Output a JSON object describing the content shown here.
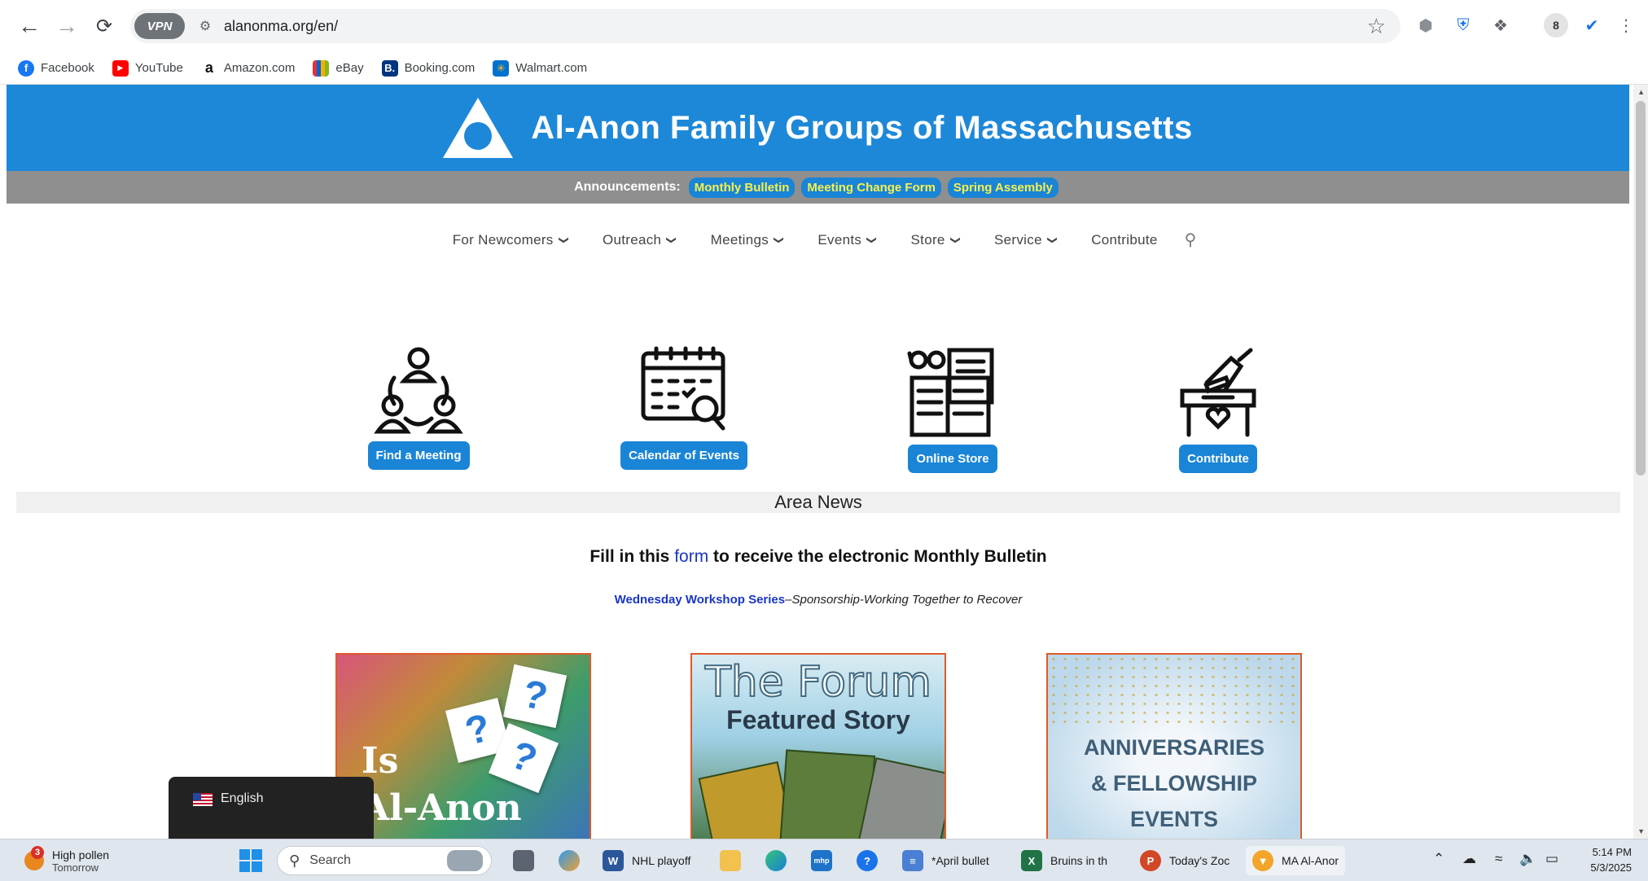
{
  "browser": {
    "vpn_label": "VPN",
    "url": "alanonma.org/en/",
    "profile_initial": "8",
    "bookmarks": [
      {
        "label": "Facebook",
        "icon": "facebook-icon",
        "color": "#1877f2",
        "glyph": "f"
      },
      {
        "label": "YouTube",
        "icon": "youtube-icon",
        "color": "#ff0000",
        "glyph": "▶"
      },
      {
        "label": "Amazon.com",
        "icon": "amazon-icon",
        "color": "#ffffff",
        "glyph": "a"
      },
      {
        "label": "eBay",
        "icon": "ebay-icon",
        "color": "#ffffff",
        "glyph": "🛍"
      },
      {
        "label": "Booking.com",
        "icon": "booking-icon",
        "color": "#003580",
        "glyph": "B."
      },
      {
        "label": "Walmart.com",
        "icon": "walmart-icon",
        "color": "#0071ce",
        "glyph": "✳"
      }
    ]
  },
  "site": {
    "title": "Al-Anon Family Groups of Massachusetts",
    "announcements_label": "Announcements:",
    "announcements": [
      "Monthly Bulletin",
      "Meeting Change Form",
      "Spring Assembly"
    ],
    "nav": [
      {
        "label": "For Newcomers",
        "has_dropdown": true
      },
      {
        "label": "Outreach",
        "has_dropdown": true
      },
      {
        "label": "Meetings",
        "has_dropdown": true
      },
      {
        "label": "Events",
        "has_dropdown": true
      },
      {
        "label": "Store",
        "has_dropdown": true
      },
      {
        "label": "Service",
        "has_dropdown": true
      },
      {
        "label": "Contribute",
        "has_dropdown": false
      }
    ],
    "features": [
      {
        "label": "Find a Meeting",
        "icon": "people-meeting-icon"
      },
      {
        "label": "Calendar of Events",
        "icon": "calendar-search-icon"
      },
      {
        "label": "Online Store",
        "icon": "book-glasses-icon"
      },
      {
        "label": "Contribute",
        "icon": "donation-box-icon"
      }
    ],
    "area_news": "Area News",
    "bulletin": {
      "before": "Fill in this ",
      "link": "form",
      "after": " to receive the electronic Monthly  Bulletin"
    },
    "workshop": {
      "link": "Wednesday Workshop Series",
      "text": "–Sponsorship-Working Together to Recover"
    },
    "cards": {
      "card1": {
        "line1": "Is",
        "line2": "Al-Anon"
      },
      "card2": {
        "title": "The Forum",
        "subtitle": "Featured Story"
      },
      "card3": {
        "line1": "ANNIVERSARIES",
        "line2": "& FELLOWSHIP",
        "line3": "EVENTS"
      }
    },
    "language": "English"
  },
  "taskbar": {
    "weather_badge": "3",
    "weather_title": "High pollen",
    "weather_sub": "Tomorrow",
    "search_placeholder": "Search",
    "apps": [
      {
        "label": "NHL playoff",
        "icon": "word-icon",
        "color": "#2b579a",
        "glyph": "W"
      },
      {
        "label": "*April bullet",
        "icon": "notepad-icon",
        "color": "#4a7fd4",
        "glyph": "≡"
      },
      {
        "label": "Bruins in th",
        "icon": "excel-icon",
        "color": "#217346",
        "glyph": "X"
      },
      {
        "label": "Today's Zoc",
        "icon": "powerpoint-icon",
        "color": "#d24726",
        "glyph": "P"
      },
      {
        "label": "MA Al-Anor",
        "icon": "browser-icon",
        "color": "#4a6fe0",
        "glyph": "▼"
      }
    ],
    "time": "5:14 PM",
    "date": "5/3/2025"
  }
}
